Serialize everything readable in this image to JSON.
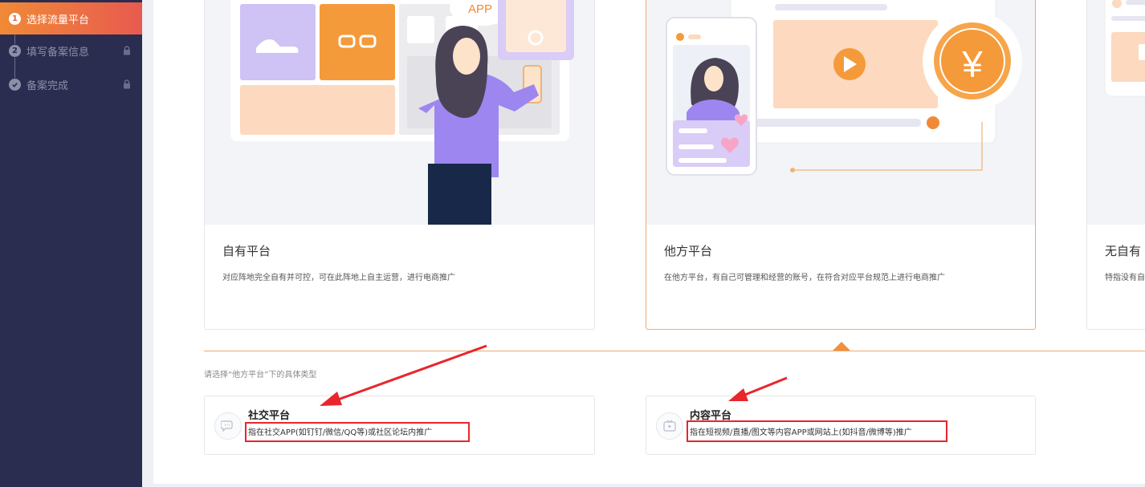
{
  "steps": [
    {
      "number": "1",
      "label": "选择流量平台"
    },
    {
      "number": "2",
      "label": "填写备案信息"
    },
    {
      "number": "",
      "label": "备案完成"
    }
  ],
  "cards": [
    {
      "title": "自有平台",
      "desc": "对应阵地完全自有并可控，可在此阵地上自主运营，进行电商推广",
      "illus_text": "APP"
    },
    {
      "title": "他方平台",
      "desc": "在他方平台，有自己可管理和经营的账号，在符合对应平台规范上进行电商推广",
      "illus_text": "¥"
    },
    {
      "title": "无自有",
      "desc": "特指没有自"
    }
  ],
  "hint": "请选择“他方平台”下的具体类型",
  "sub_cards": [
    {
      "title": "社交平台",
      "desc": "指在社交APP(如钉钉/微信/QQ等)或社区论坛内推广",
      "icon": "chat-bubble-icon"
    },
    {
      "title": "内容平台",
      "desc": "指在短视频/直播/图文等内容APP或网站上(如抖音/微博等)推广",
      "icon": "video-icon"
    }
  ],
  "colors": {
    "accent": "#f08a36",
    "sidebar": "#2a2d4f",
    "annotation": "#e8262b"
  }
}
